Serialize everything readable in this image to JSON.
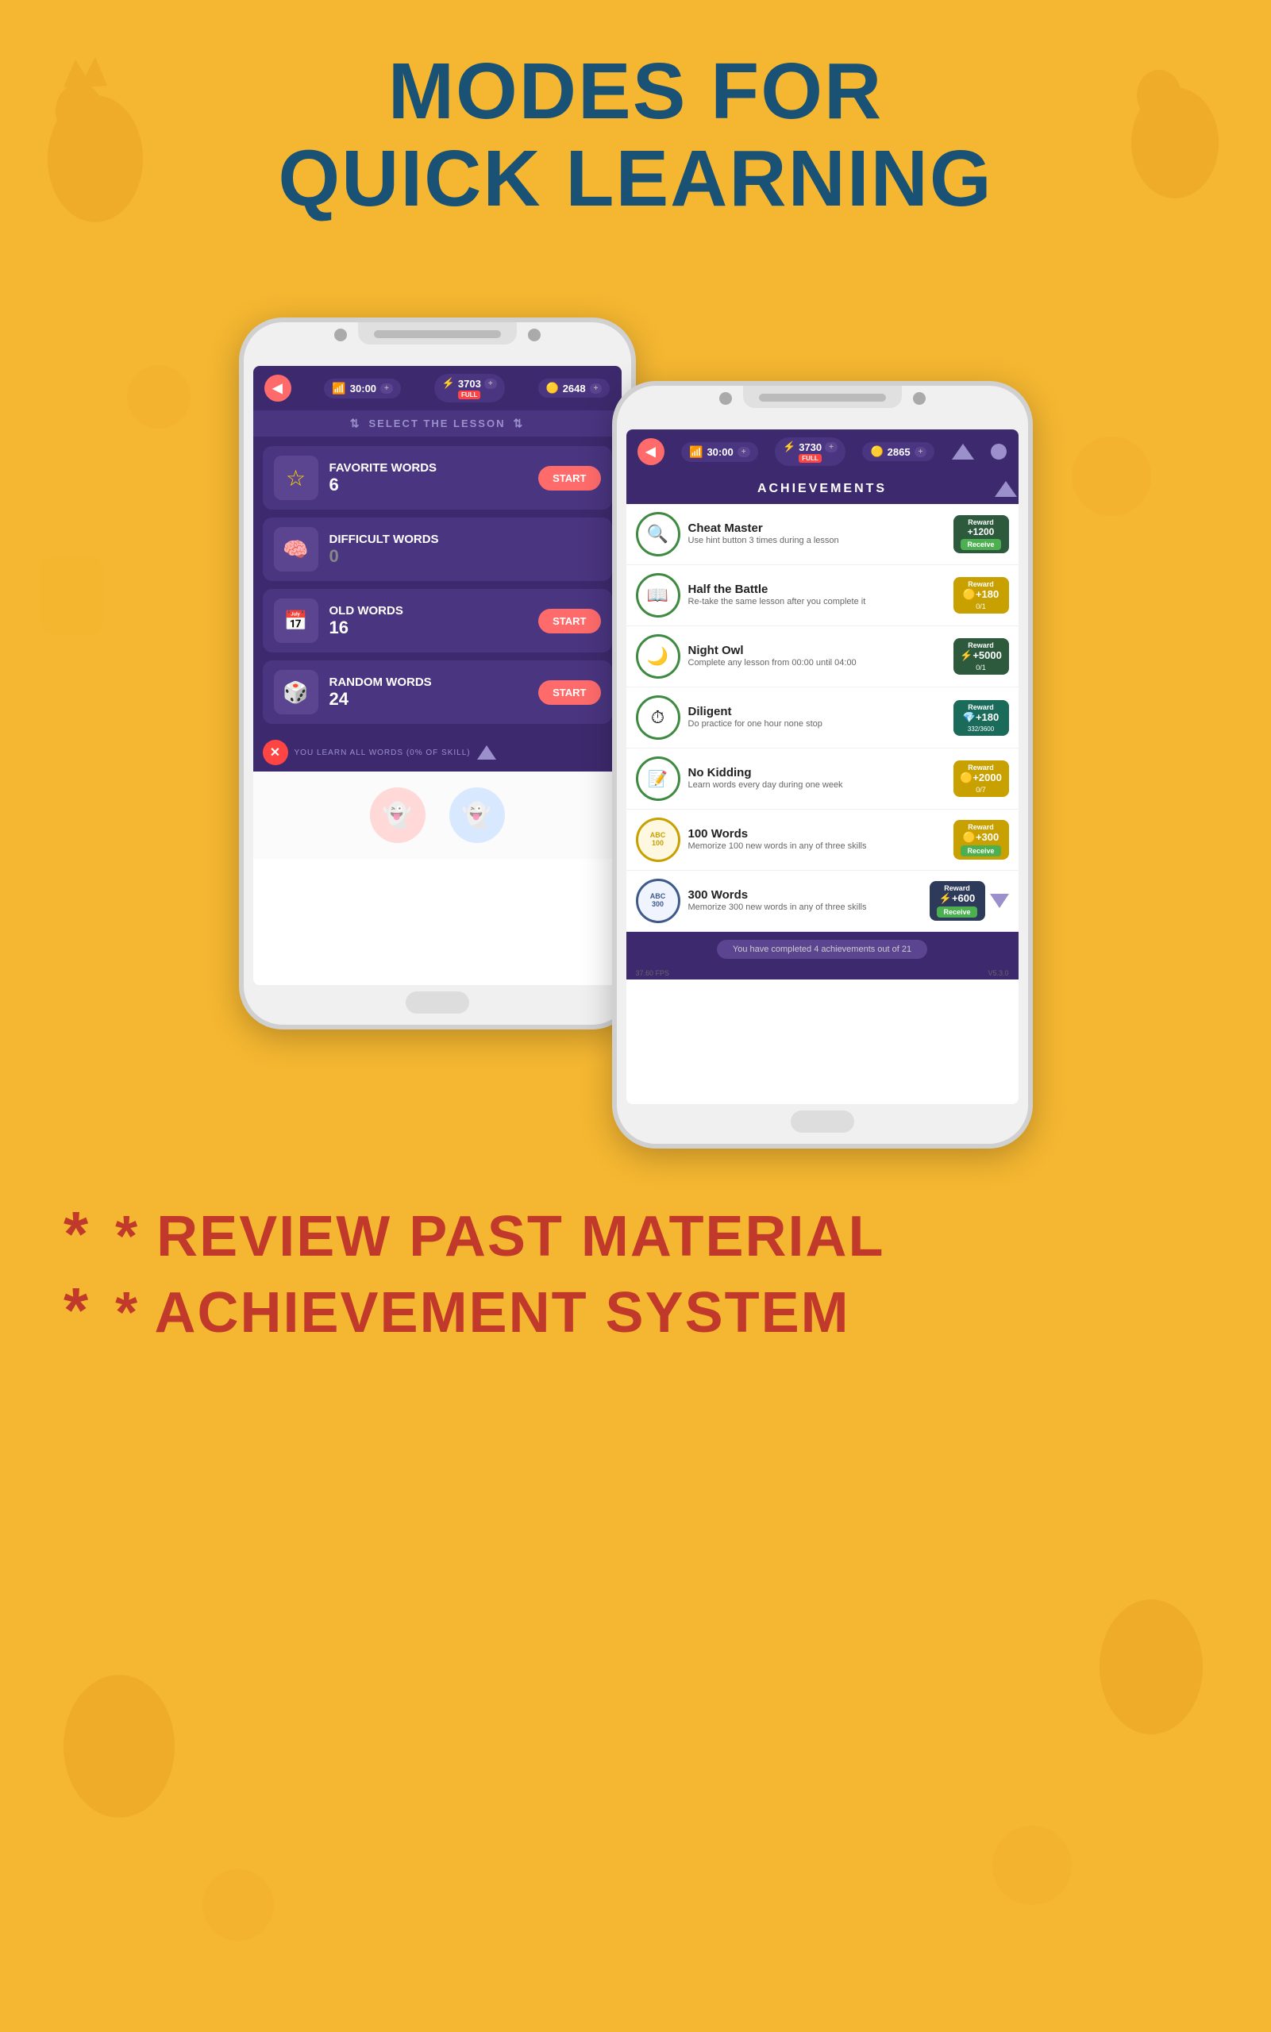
{
  "page": {
    "background_color": "#F5B731",
    "title_line1": "MODES FOR",
    "title_line2": "QUICK LEARNING",
    "bottom_bullets": [
      "* REVIEW PAST MATERIAL",
      "* ACHIEVEMENT SYSTEM"
    ]
  },
  "phone1": {
    "header": {
      "time": "30:00",
      "time_plus": "+",
      "lightning": "3703",
      "lightning_sub": "FULL",
      "lightning_plus": "+",
      "coin": "2648",
      "coin_plus": "+"
    },
    "screen_title": "SELECT THE LESSON",
    "lessons": [
      {
        "name": "FAVORITE WORDS",
        "count": "6",
        "icon": "★",
        "has_start": true,
        "start_label": "START"
      },
      {
        "name": "DIFFICULT WORDS",
        "count": "0",
        "icon": "🧠",
        "has_start": false
      },
      {
        "name": "OLD WORDS",
        "count": "16",
        "icon": "📅",
        "has_start": true,
        "start_label": "START"
      },
      {
        "name": "RANDOM WORDS",
        "count": "24",
        "icon": "🎲",
        "has_start": true,
        "start_label": "START"
      }
    ],
    "bottom_bar_text": "YOU LEARN ALL WORDS (0% OF SKILL)"
  },
  "phone2": {
    "header": {
      "time": "30:00",
      "time_plus": "+",
      "lightning": "3730",
      "lightning_sub": "FULL",
      "lightning_plus": "+",
      "coin": "2865",
      "coin_plus": "+"
    },
    "screen_title": "ACHIEVEMENTS",
    "achievements": [
      {
        "name": "Cheat Master",
        "desc": "Use hint button 3 times during a lesson",
        "icon": "🔍",
        "border_color": "#3D8A40",
        "reward_type": "lightning",
        "reward_amount": "+1200",
        "reward_status": "Receive",
        "reward_bg": "green"
      },
      {
        "name": "Half the Battle",
        "desc": "Re-take the same lesson after you complete it",
        "icon": "📖",
        "border_color": "#3D8A40",
        "reward_type": "coin",
        "reward_amount": "+180",
        "reward_status": "0/1",
        "reward_bg": "gold"
      },
      {
        "name": "Night Owl",
        "desc": "Complete any lesson from 00:00 until 04:00",
        "icon": "🌙",
        "border_color": "#3D8A40",
        "reward_type": "lightning",
        "reward_amount": "+5000",
        "reward_status": "0/1",
        "reward_bg": "green"
      },
      {
        "name": "Diligent",
        "desc": "Do practice for one hour none stop",
        "icon": "⏱",
        "border_color": "#3D8A40",
        "reward_type": "diamond",
        "reward_amount": "+180",
        "reward_status": "332/3600",
        "reward_bg": "teal"
      },
      {
        "name": "No Kidding",
        "desc": "Learn words every day during one week",
        "icon": "📝",
        "border_color": "#3D8A40",
        "reward_type": "coin",
        "reward_amount": "+2000",
        "reward_status": "0/7",
        "reward_bg": "gold"
      },
      {
        "name": "100 Words",
        "desc": "Memorize 100 new words in any of three skills",
        "icon": "ABC\n100",
        "border_color": "#C8A000",
        "reward_type": "coin",
        "reward_amount": "+300",
        "reward_status": "Receive",
        "reward_bg": "gold"
      },
      {
        "name": "300 Words",
        "desc": "Memorize 300 new words in any of three skills",
        "icon": "ABC\n300",
        "border_color": "#3D5A8A",
        "reward_type": "lightning",
        "reward_amount": "+600",
        "reward_status": "Receive",
        "reward_bg": "dark"
      }
    ],
    "footer_text": "You have completed 4 achievements out of 21",
    "version": "V5.3.0",
    "fps": "37.60 FPS"
  }
}
